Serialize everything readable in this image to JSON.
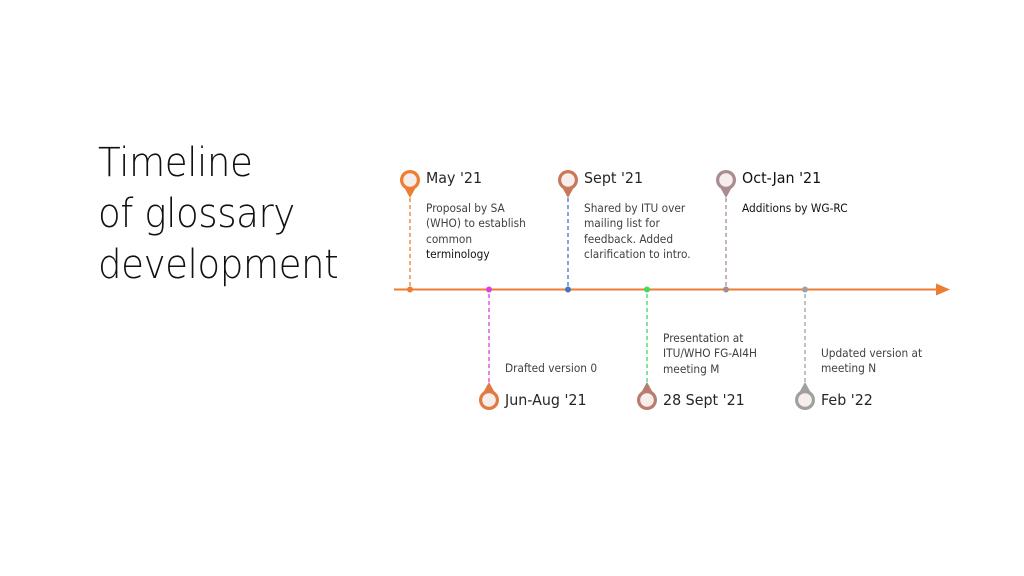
{
  "title": {
    "lines": [
      "Timeline",
      "of glossary",
      "development"
    ]
  },
  "timeline": {
    "axis_color": "#ED7D31",
    "events": [
      {
        "id": "may-21",
        "date": "May '21",
        "description_lines": [
          "Proposal by SA",
          "(WHO) to establish",
          "common",
          "terminology"
        ],
        "position": "above",
        "pin_color": "#ED7D31",
        "line_color": "#ED7D31"
      },
      {
        "id": "jun-aug-21",
        "date": "Jun-Aug '21",
        "description_lines": [
          "Drafted version 0"
        ],
        "position": "below",
        "pin_color": "#E07A44",
        "line_color": "#E03FE0"
      },
      {
        "id": "sept-21",
        "date": "Sept '21",
        "description_lines": [
          "Shared by ITU over",
          "mailing list for",
          "feedback. Added",
          "clarification to intro."
        ],
        "position": "above",
        "pin_color": "#C9785A",
        "line_color": "#4472C4"
      },
      {
        "id": "28-sept-21",
        "date": "28 Sept '21",
        "description_lines": [
          "Presentation at",
          "ITU/WHO FG-AI4H",
          "meeting M"
        ],
        "position": "below",
        "pin_color": "#B97D70",
        "line_color": "#3DDC5A"
      },
      {
        "id": "oct-jan-21",
        "date": "Oct-Jan '21",
        "description_lines": [
          "Additions by WG-RC"
        ],
        "position": "above",
        "pin_color": "#A88C90",
        "line_color": "#A88C90"
      },
      {
        "id": "feb-22",
        "date": "Feb '22",
        "description_lines": [
          "Updated version at",
          "meeting N"
        ],
        "position": "below",
        "pin_color": "#A0A0A0",
        "line_color": "#A0A0A0"
      }
    ]
  }
}
